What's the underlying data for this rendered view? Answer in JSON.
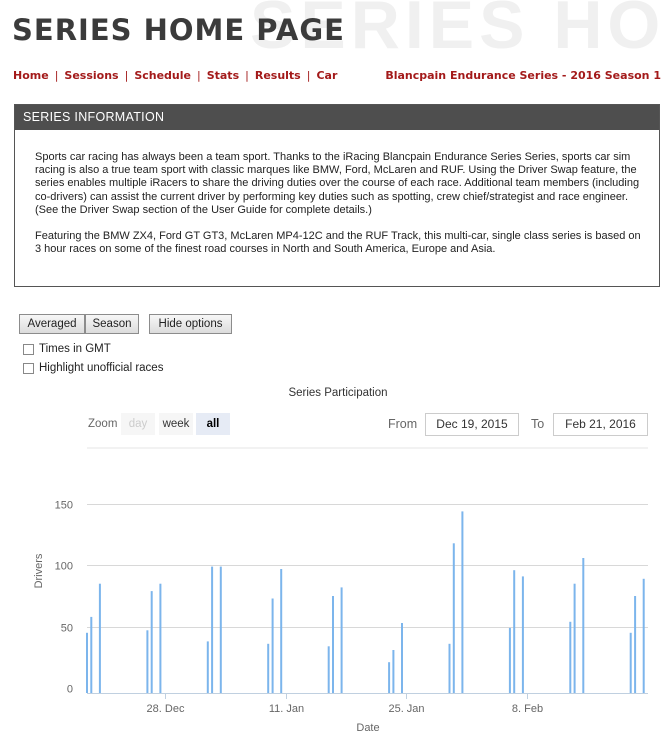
{
  "header": {
    "title": "SERIES HOME PAGE",
    "bg_text": "SERIES HOME"
  },
  "nav": {
    "items": [
      {
        "label": "Home"
      },
      {
        "label": "Sessions"
      },
      {
        "label": "Schedule"
      },
      {
        "label": "Stats"
      },
      {
        "label": "Results"
      },
      {
        "label": "Car"
      }
    ],
    "series_name": "Blancpain Endurance Series - 2016 Season 1"
  },
  "info": {
    "heading": "SERIES INFORMATION",
    "paragraph1": "Sports car racing has always been a team sport. Thanks to the iRacing Blancpain Endurance Series Series, sports car sim racing is also a true team sport with classic marques like BMW, Ford, McLaren and RUF. Using the Driver Swap feature, the series enables multiple iRacers to share the driving duties over the course of each race. Additional team members (including co-drivers) can assist the current driver by performing key duties such as spotting, crew chief/strategist and race engineer. (See the Driver Swap section of the User Guide for complete details.)",
    "paragraph2": "Featuring the BMW ZX4, Ford GT GT3, McLaren MP4-12C and the RUF Track, this multi-car, single class series is based on 3 hour races on some of the finest road courses in North and South America, Europe and Asia."
  },
  "controls": {
    "averaged_label": "Averaged",
    "season_label": "Season",
    "hide_options_label": "Hide options",
    "times_gmt_label": "Times in GMT",
    "highlight_label": "Highlight unofficial races"
  },
  "zoom": {
    "label": "Zoom",
    "day": "day",
    "week": "week",
    "all": "all",
    "from_label": "From",
    "from_value": "Dec 19, 2015",
    "to_label": "To",
    "to_value": "Feb 21, 2016"
  },
  "colors": {
    "accent": "#a31a1a",
    "bar": "#7cb5ec",
    "header_bg": "#4e4e4e"
  },
  "chart_data": {
    "type": "bar",
    "title": "Series Participation",
    "xlabel": "Date",
    "ylabel": "Drivers",
    "ylim": [
      0,
      150
    ],
    "yticks": [
      0,
      50,
      100,
      150
    ],
    "xlim": [
      "2015-12-19",
      "2016-02-21"
    ],
    "xticks": [
      {
        "date": "2015-12-28",
        "label": "28. Dec"
      },
      {
        "date": "2016-01-11",
        "label": "11. Jan"
      },
      {
        "date": "2016-01-25",
        "label": "25. Jan"
      },
      {
        "date": "2016-02-08",
        "label": "8. Feb"
      }
    ],
    "grid": true,
    "series": [
      {
        "values": [
          {
            "x": "2015-12-19 00:00",
            "y": 45
          },
          {
            "x": "2015-12-19 12:00",
            "y": 58
          },
          {
            "x": "2015-12-20 12:00",
            "y": 85
          },
          {
            "x": "2015-12-26 00:00",
            "y": 47
          },
          {
            "x": "2015-12-26 12:00",
            "y": 79
          },
          {
            "x": "2015-12-27 12:00",
            "y": 85
          },
          {
            "x": "2016-01-02 00:00",
            "y": 38
          },
          {
            "x": "2016-01-02 12:00",
            "y": 99
          },
          {
            "x": "2016-01-03 12:00",
            "y": 99
          },
          {
            "x": "2016-01-09 00:00",
            "y": 36
          },
          {
            "x": "2016-01-09 12:00",
            "y": 73
          },
          {
            "x": "2016-01-10 12:00",
            "y": 97
          },
          {
            "x": "2016-01-16 00:00",
            "y": 34
          },
          {
            "x": "2016-01-16 12:00",
            "y": 75
          },
          {
            "x": "2016-01-17 12:00",
            "y": 82
          },
          {
            "x": "2016-01-23 00:00",
            "y": 21
          },
          {
            "x": "2016-01-23 12:00",
            "y": 31
          },
          {
            "x": "2016-01-24 12:00",
            "y": 53
          },
          {
            "x": "2016-01-30 00:00",
            "y": 36
          },
          {
            "x": "2016-01-30 12:00",
            "y": 118
          },
          {
            "x": "2016-01-31 12:00",
            "y": 144
          },
          {
            "x": "2016-02-06 00:00",
            "y": 49
          },
          {
            "x": "2016-02-06 12:00",
            "y": 96
          },
          {
            "x": "2016-02-07 12:00",
            "y": 91
          },
          {
            "x": "2016-02-13 00:00",
            "y": 54
          },
          {
            "x": "2016-02-13 12:00",
            "y": 85
          },
          {
            "x": "2016-02-14 12:00",
            "y": 106
          },
          {
            "x": "2016-02-20 00:00",
            "y": 45
          },
          {
            "x": "2016-02-20 12:00",
            "y": 75
          },
          {
            "x": "2016-02-21 12:00",
            "y": 89
          }
        ]
      }
    ]
  }
}
